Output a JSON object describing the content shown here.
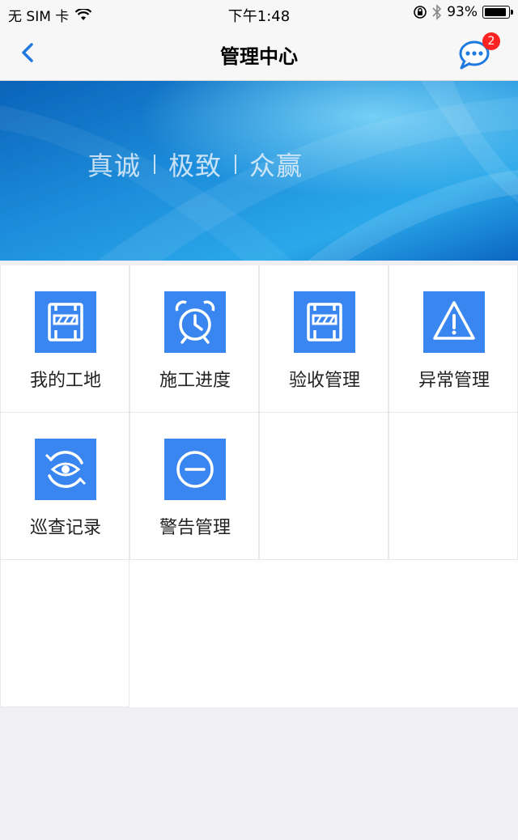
{
  "status_bar": {
    "carrier": "无 SIM 卡",
    "time": "下午1:48",
    "battery": "93%",
    "battery_level": 0.93
  },
  "nav": {
    "title": "管理中心",
    "message_badge": "2"
  },
  "banner": {
    "slogan": [
      "真诚",
      "极致",
      "众赢"
    ]
  },
  "grid": {
    "items": [
      {
        "label": "我的工地",
        "icon": "construction-barrier-icon"
      },
      {
        "label": "施工进度",
        "icon": "alarm-clock-icon"
      },
      {
        "label": "验收管理",
        "icon": "construction-barrier-icon"
      },
      {
        "label": "异常管理",
        "icon": "warning-triangle-icon"
      },
      {
        "label": "巡查记录",
        "icon": "eye-refresh-icon"
      },
      {
        "label": "警告管理",
        "icon": "minus-circle-icon"
      }
    ]
  },
  "colors": {
    "accent": "#3a86f0",
    "nav_icon": "#1f7ae0",
    "badge": "#ff2222"
  }
}
